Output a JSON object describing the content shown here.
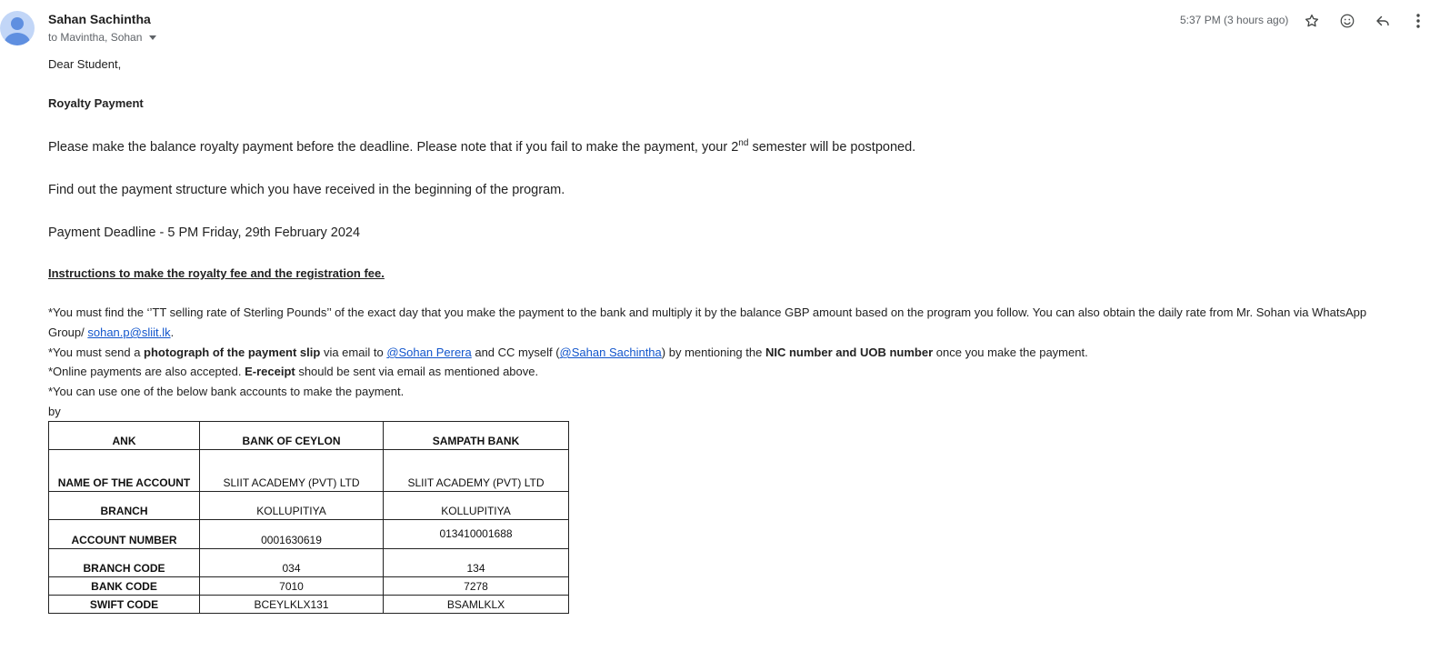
{
  "header": {
    "sender": "Sahan Sachintha",
    "recipients": "to Mavintha, Sohan",
    "timestamp": "5:37 PM (3 hours ago)"
  },
  "icons": {
    "avatar": "person-avatar",
    "star": "star-icon",
    "emoji": "emoji-icon",
    "reply": "reply-icon",
    "more": "more-vert-icon"
  },
  "email": {
    "greeting": "Dear Student,",
    "subject_heading": "Royalty Payment",
    "para1_a": "Please make the balance royalty payment before the deadline. Please note that if you fail to make the payment, your 2",
    "para1_sup": "nd",
    "para1_b": " semester will be postponed.",
    "para2": "Find out the payment structure which you have received in the beginning of the program.",
    "deadline": "Payment Deadline - 5 PM Friday, 29th February 2024",
    "instructions_heading": "Instructions to make the royalty fee and the registration fee.",
    "line1": "*You must find the ‘’TT selling rate of Sterling Pounds’’ of the exact day that you make the payment to the bank and multiply it by the balance GBP amount based on the program you follow. You can also obtain the daily rate from Mr. Sohan via WhatsApp",
    "line2_a": "Group/  ",
    "line2_link": "sohan.p@sliit.lk",
    "line2_b": ".",
    "line3_a": "*You must send a ",
    "line3_b": "photograph of the payment slip",
    "line3_c": " via email to ",
    "line3_link1": "@Sohan Perera",
    "line3_d": " and CC myself (",
    "line3_link2": "@Sahan Sachintha",
    "line3_e": ") by mentioning the ",
    "line3_f": "NIC number and UOB number",
    "line3_g": " once you make the payment.",
    "line4_a": "*Online payments are also accepted. ",
    "line4_b": "E-receipt",
    "line4_c": " should be sent via email as mentioned above.",
    "line5": "*You can use one of the below bank accounts to make the payment.",
    "by": " by"
  },
  "table": {
    "header": [
      "ANK",
      "BANK OF CEYLON",
      "SAMPATH BANK"
    ],
    "rows": [
      [
        "NAME OF THE ACCOUNT",
        "SLIIT ACADEMY (PVT) LTD",
        "SLIIT ACADEMY (PVT) LTD"
      ],
      [
        "BRANCH",
        "KOLLUPITIYA",
        "KOLLUPITIYA"
      ],
      [
        "ACCOUNT NUMBER",
        "0001630619",
        "013410001688"
      ],
      [
        "BRANCH CODE",
        "034",
        "134"
      ],
      [
        "BANK CODE",
        "7010",
        "7278"
      ],
      [
        "SWIFT CODE",
        "BCEYLKLX131",
        "BSAMLKLX"
      ]
    ]
  }
}
